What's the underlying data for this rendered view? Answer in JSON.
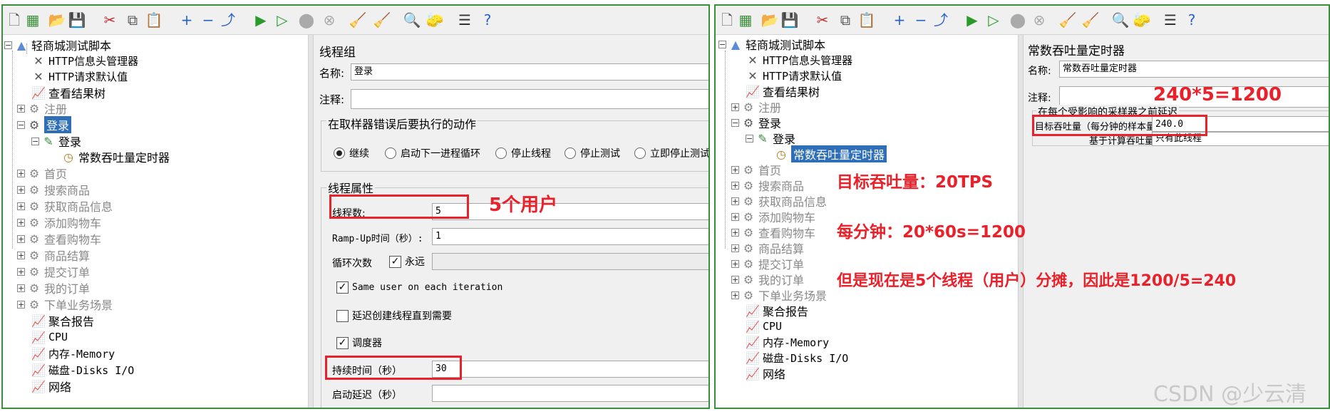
{
  "colors": {
    "panel_border": "#3a8f3a",
    "highlight": "#e8212a",
    "selection": "#2f6fb8"
  },
  "toolbar_icons": [
    "new-icon",
    "templates-icon",
    "open-icon",
    "save-icon",
    "cut-icon",
    "copy-icon",
    "paste-icon",
    "expand-icon",
    "collapse-icon",
    "toggle-icon",
    "start-icon",
    "start-no-timers-icon",
    "stop-icon",
    "shutdown-icon",
    "clear-icon",
    "clear-all-icon",
    "search-icon",
    "reset-search-icon",
    "function-helper-icon",
    "help-icon"
  ],
  "left": {
    "tree": {
      "root": "轻商城测试脚本",
      "header_manager": "HTTP信息头管理器",
      "request_defaults": "HTTP请求默认值",
      "results_tree": "查看结果树",
      "register": "注册",
      "login_group": "登录",
      "login_sampler": "登录",
      "timer": "常数吞吐量定时器",
      "home": "首页",
      "search_goods": "搜索商品",
      "goods_info": "获取商品信息",
      "add_cart": "添加购物车",
      "view_cart": "查看购物车",
      "checkout": "商品结算",
      "submit_order": "提交订单",
      "my_orders": "我的订单",
      "order_scene": "下单业务场景",
      "aggregate_report": "聚合报告",
      "cpu": "CPU",
      "memory": "内存-Memory",
      "disks": "磁盘-Disks I/O",
      "network": "网络"
    },
    "form": {
      "title": "线程组",
      "name_label": "名称:",
      "name_value": "登录",
      "comment_label": "注释:",
      "comment_value": "",
      "error_group": "在取样器错误后要执行的动作",
      "radio_continue": "继续",
      "radio_next_loop": "启动下一进程循环",
      "radio_stop_thread": "停止线程",
      "radio_stop_test": "停止测试",
      "radio_stop_now": "立即停止测试",
      "props_group": "线程属性",
      "threads_label": "线程数:",
      "threads_value": "5",
      "rampup_label": "Ramp-Up时间（秒）:",
      "rampup_value": "1",
      "loop_label": "循环次数",
      "forever_label": "永远",
      "loop_value": "",
      "same_user_label": "Same user on each iteration",
      "delay_create_label": "延迟创建线程直到需要",
      "scheduler_label": "调度器",
      "duration_label": "持续时间（秒）",
      "duration_value": "30",
      "startup_delay_label": "启动延迟（秒）",
      "startup_delay_value": ""
    },
    "annotations": {
      "users": "5个用户"
    }
  },
  "right": {
    "tree": {
      "root": "轻商城测试脚本",
      "header_manager": "HTTP信息头管理器",
      "request_defaults": "HTTP请求默认值",
      "results_tree": "查看结果树",
      "register": "注册",
      "login_group": "登录",
      "login_sampler": "登录",
      "timer": "常数吞吐量定时器",
      "home": "首页",
      "search_goods": "搜索商品",
      "goods_info": "获取商品信息",
      "add_cart": "添加购物车",
      "view_cart": "查看购物车",
      "checkout": "商品结算",
      "submit_order": "提交订单",
      "my_orders": "我的订单",
      "order_scene": "下单业务场景",
      "aggregate_report": "聚合报告",
      "cpu": "CPU",
      "memory": "内存-Memory",
      "disks": "磁盘-Disks I/O",
      "network": "网络"
    },
    "form": {
      "title": "常数吞吐量定时器",
      "name_label": "名称:",
      "name_value": "常数吞吐量定时器",
      "comment_label": "注释:",
      "comment_value": "",
      "delay_group": "在每个受影响的采样器之前延迟",
      "target_label": "目标吞吐量（每分钟的样本量）:",
      "target_value": "240.0",
      "basis_label": "基于计算吞吐量:",
      "basis_value": "只有此线程"
    },
    "annotations": {
      "calc": "240*5=1200",
      "target_tps": "目标吞吐量：20TPS",
      "per_minute": "每分钟：20*60s=1200",
      "shared": "但是现在是5个线程（用户）分摊，因此是1200/5=240"
    }
  },
  "watermark": "CSDN @少云清"
}
